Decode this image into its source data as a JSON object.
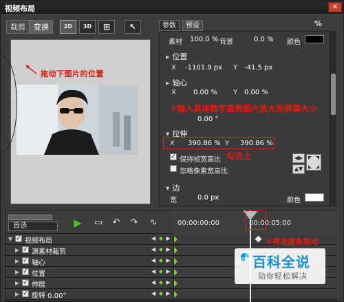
{
  "window": {
    "title": "视频布局",
    "close": "✕"
  },
  "left_tabs": [
    "裁剪",
    "变换"
  ],
  "toolbar": {
    "btn_2d": "2D",
    "btn_3d": "3D",
    "btn_grid": "⊞",
    "btn_pointer": "↖"
  },
  "right_tabs": [
    "参数",
    "预设"
  ],
  "percent_label": "%",
  "params": {
    "material_label": "素材",
    "material_value": "100.0 %",
    "background_label": "背景",
    "background_value": "0.0 %",
    "color_label": "颜色",
    "color_value": "#000000",
    "position_section": "位置",
    "position_x_label": "X",
    "position_x_value": "-1101.9 px",
    "position_y_label": "Y",
    "position_y_value": "-41.5 px",
    "anchor_section": "轴心",
    "anchor_x_label": "X",
    "anchor_x_value": "0.00 %",
    "anchor_y_label": "Y",
    "anchor_y_value": "0.00 %",
    "rotation_value": "0.00 °",
    "stretch_section": "拉伸",
    "stretch_x_label": "X",
    "stretch_x_value": "390.86 %",
    "stretch_y_label": "Y",
    "stretch_y_value": "390.86 %",
    "keep_aspect_label": "保持帧宽高比",
    "keep_aspect_checked": true,
    "ignore_pixel_label": "忽略像素宽高比",
    "ignore_pixel_checked": false,
    "border_section": "边",
    "border_width_label": "宽",
    "border_width_value": "0.0 px",
    "border_color_label": "颜色",
    "border_color_value": "#ffffff"
  },
  "annotations": {
    "drag_hint": "拖动下图片的位置",
    "input_hint": "②输入具体数字直到图片放大到屏幕大小",
    "check_hint": "勾选上",
    "drag_timeline_hint": "①将进度条拖动"
  },
  "timeline": {
    "auto_label": "自选",
    "timecode_start": "00:00:00:00",
    "timecode_end": "00:00:05:00",
    "tracks": [
      {
        "name": "视频布局",
        "keyframes": "◀ ◆ ▶",
        "checked": true
      },
      {
        "name": "源素材裁剪",
        "keyframes": "◀ ◆ ▶",
        "checked": true
      },
      {
        "name": "轴心",
        "keyframes": "◀ ◆ ▶",
        "checked": true
      },
      {
        "name": "位置",
        "keyframes": "◀ ◆ ▶",
        "checked": true
      },
      {
        "name": "伸展",
        "keyframes": "◀ ◆ ▶",
        "checked": true
      },
      {
        "name": "旋转   0.00°",
        "keyframes": "◀ ◆ ▶",
        "checked": true
      }
    ]
  },
  "watermark": {
    "brand": "百科全说",
    "slogan": "助你轻松解决"
  },
  "colors": {
    "accent_red": "#e41b11",
    "play_green": "#4fc11e",
    "watermark_blue": "#1e90c9"
  }
}
